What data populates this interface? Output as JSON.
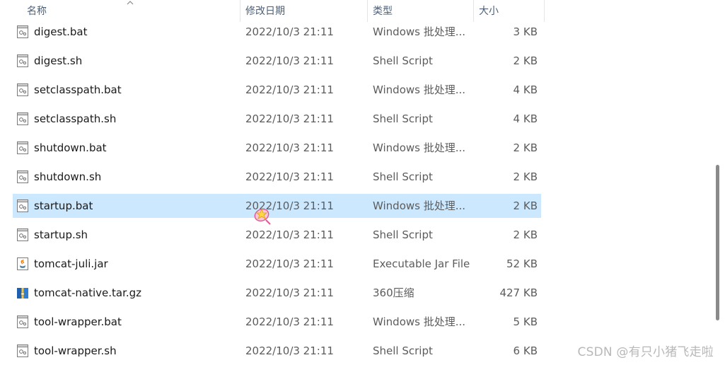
{
  "columns": {
    "name": "名称",
    "modified": "修改日期",
    "type": "类型",
    "size": "大小"
  },
  "files": [
    {
      "name": "digest.bat",
      "modified": "2022/10/3 21:11",
      "type": "Windows 批处理...",
      "size": "3 KB",
      "icon": "batch-file-icon"
    },
    {
      "name": "digest.sh",
      "modified": "2022/10/3 21:11",
      "type": "Shell Script",
      "size": "2 KB",
      "icon": "shell-script-icon"
    },
    {
      "name": "setclasspath.bat",
      "modified": "2022/10/3 21:11",
      "type": "Windows 批处理...",
      "size": "4 KB",
      "icon": "batch-file-icon"
    },
    {
      "name": "setclasspath.sh",
      "modified": "2022/10/3 21:11",
      "type": "Shell Script",
      "size": "4 KB",
      "icon": "shell-script-icon"
    },
    {
      "name": "shutdown.bat",
      "modified": "2022/10/3 21:11",
      "type": "Windows 批处理...",
      "size": "2 KB",
      "icon": "batch-file-icon"
    },
    {
      "name": "shutdown.sh",
      "modified": "2022/10/3 21:11",
      "type": "Shell Script",
      "size": "2 KB",
      "icon": "shell-script-icon"
    },
    {
      "name": "startup.bat",
      "modified": "2022/10/3 21:11",
      "type": "Windows 批处理...",
      "size": "2 KB",
      "icon": "batch-file-icon",
      "selected": true
    },
    {
      "name": "startup.sh",
      "modified": "2022/10/3 21:11",
      "type": "Shell Script",
      "size": "2 KB",
      "icon": "shell-script-icon"
    },
    {
      "name": "tomcat-juli.jar",
      "modified": "2022/10/3 21:11",
      "type": "Executable Jar File",
      "size": "52 KB",
      "icon": "java-jar-icon"
    },
    {
      "name": "tomcat-native.tar.gz",
      "modified": "2022/10/3 21:11",
      "type": "360压缩",
      "size": "427 KB",
      "icon": "archive-icon"
    },
    {
      "name": "tool-wrapper.bat",
      "modified": "2022/10/3 21:11",
      "type": "Windows 批处理...",
      "size": "5 KB",
      "icon": "batch-file-icon"
    },
    {
      "name": "tool-wrapper.sh",
      "modified": "2022/10/3 21:11",
      "type": "Shell Script",
      "size": "6 KB",
      "icon": "shell-script-icon"
    }
  ],
  "watermark": "CSDN @有只小猪飞走啦",
  "colors": {
    "selected_row": "#cce8ff",
    "header_text": "#4c607a",
    "scrollbar": "#8a8a8a"
  }
}
